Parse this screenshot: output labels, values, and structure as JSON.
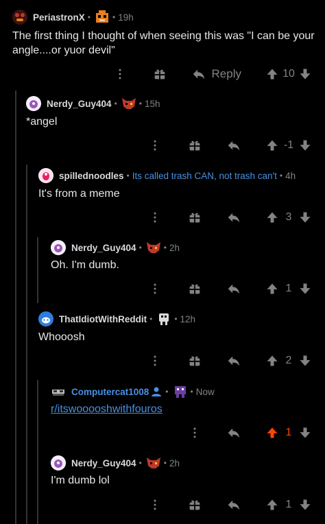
{
  "comments": [
    {
      "username": "PeriastronX",
      "time": "19h",
      "body": "The first thing I thought of when seeing this was \"I can be your angle....or yuor devil\"",
      "reply_label": "Reply",
      "score": "10",
      "avatar_color": "#7a1f1f",
      "flair_icon": "freddy-icon"
    },
    {
      "username": "Nerdy_Guy404",
      "time": "15h",
      "body": "*angel",
      "score": "-1",
      "avatar_color": "#b9a0d8",
      "flair_icon": "foxy-icon"
    },
    {
      "username": "spillednoodles",
      "flair_text": "Its called trash CAN, not trash can't",
      "time": "4h",
      "body": "It's from a meme",
      "score": "3",
      "avatar_color": "#e6b0d8"
    },
    {
      "username": "Nerdy_Guy404",
      "time": "2h",
      "body": "Oh. I'm dumb.",
      "score": "1",
      "avatar_color": "#b9a0d8",
      "flair_icon": "foxy-icon"
    },
    {
      "username": "ThatIdiotWithReddit",
      "time": "12h",
      "body": "Whooosh",
      "score": "2",
      "avatar_color": "#4a90e2",
      "flair_icon": "endo-icon"
    },
    {
      "username": "Computercat1008",
      "time": "Now",
      "body": "r/itswooooshwithfouros",
      "score": "1",
      "avatar_color": "#222222",
      "flair_icon": "purple-guy-icon",
      "op": true
    },
    {
      "username": "Nerdy_Guy404",
      "time": "2h",
      "body": "I'm dumb lol",
      "score": "1",
      "avatar_color": "#b9a0d8",
      "flair_icon": "foxy-icon"
    }
  ],
  "colors": {
    "background": "#000000",
    "accent": "#4a90e2",
    "upvote_active": "#ff4500",
    "muted": "#818384"
  }
}
